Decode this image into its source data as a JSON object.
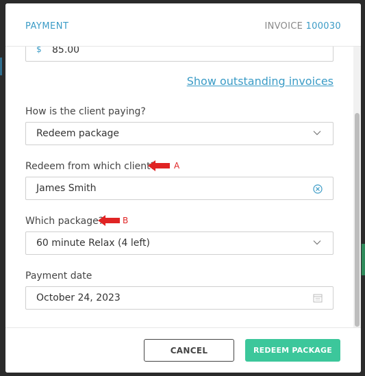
{
  "header": {
    "title": "PAYMENT",
    "invoice_label": "INVOICE",
    "invoice_number": "100030"
  },
  "form": {
    "amount": {
      "currency_symbol": "$",
      "value": "85.00"
    },
    "outstanding_link": "Show outstanding invoices",
    "payment_method": {
      "label": "How is the client paying?",
      "value": "Redeem package"
    },
    "redeem_client": {
      "label": "Redeem from which client?",
      "value": "James Smith",
      "annotation": "A"
    },
    "package": {
      "label": "Which package?",
      "value": "60 minute Relax (4 left)",
      "annotation": "B"
    },
    "payment_date": {
      "label": "Payment date",
      "value": "October 24, 2023"
    }
  },
  "footer": {
    "cancel_label": "CANCEL",
    "primary_label": "REDEEM PACKAGE"
  },
  "colors": {
    "accent": "#3a9bc6",
    "primary_button": "#3cc79b",
    "annotation": "#e02424"
  },
  "icons": {
    "dropdown": "chevron-down-icon",
    "clear": "clear-circle-icon",
    "date": "calendar-icon",
    "annotation": "red-arrow-icon"
  }
}
